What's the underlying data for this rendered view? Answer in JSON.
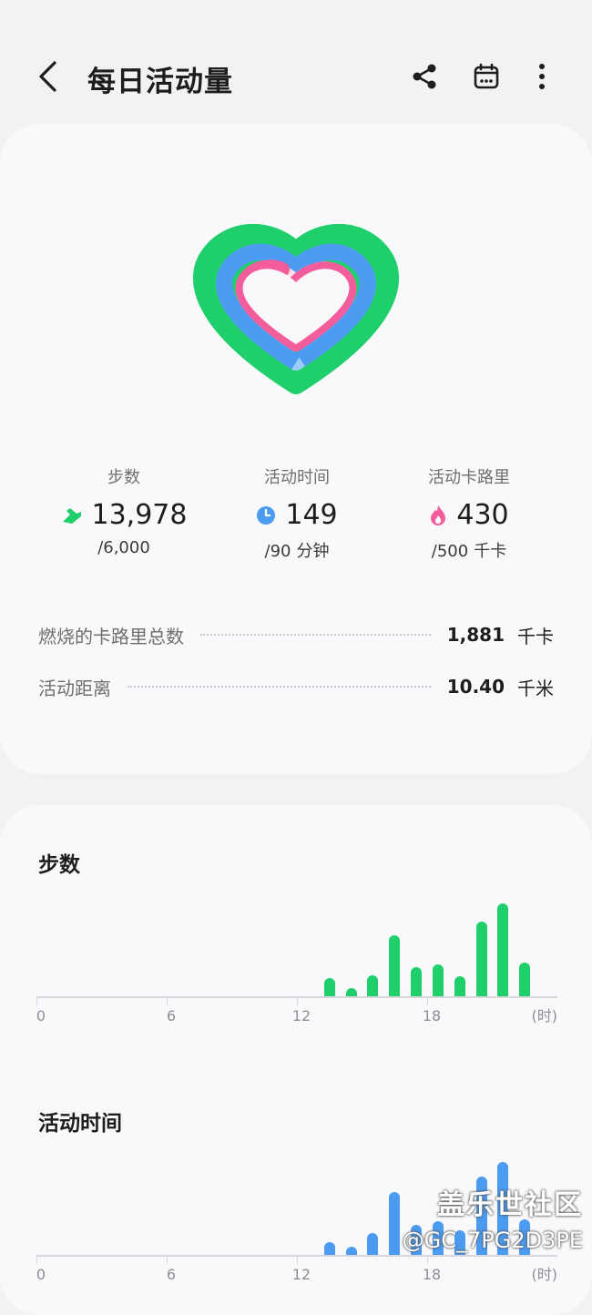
{
  "header": {
    "title": "每日活动量",
    "back_icon": "back-arrow-icon",
    "share_icon": "share-icon",
    "calendar_icon": "calendar-icon",
    "more_icon": "more-vertical-icon"
  },
  "rings": {
    "steps_progress": 1.0,
    "time_progress": 1.0,
    "calories_progress": 0.86,
    "colors": {
      "steps": "#1fcf6b",
      "time": "#4b9bf0",
      "calories": "#f45d9b"
    }
  },
  "stats": [
    {
      "label": "步数",
      "value": "13,978",
      "goal": "/6,000",
      "unit": "",
      "icon": "running-shoe-icon",
      "color": "#1fcf6b"
    },
    {
      "label": "活动时间",
      "value": "149",
      "goal": "/90",
      "unit": "分钟",
      "icon": "clock-icon",
      "color": "#4b9bf0"
    },
    {
      "label": "活动卡路里",
      "value": "430",
      "goal": "/500",
      "unit": "千卡",
      "icon": "flame-icon",
      "color": "#f45d9b"
    }
  ],
  "summary": [
    {
      "label": "燃烧的卡路里总数",
      "value": "1,881",
      "unit": "千卡"
    },
    {
      "label": "活动距离",
      "value": "10.40",
      "unit": "千米"
    }
  ],
  "sections": {
    "steps_title": "步数",
    "time_title": "活动时间"
  },
  "chart_data": [
    {
      "type": "bar",
      "title": "步数",
      "x_unit": "(时)",
      "xticks": [
        "0",
        "6",
        "12",
        "18"
      ],
      "xlim": [
        0,
        24
      ],
      "x": [
        13,
        14,
        15,
        16,
        17,
        18,
        19,
        20,
        21,
        22
      ],
      "values": [
        0.2,
        0.09,
        0.23,
        0.66,
        0.31,
        0.34,
        0.22,
        0.8,
        1.0,
        0.36
      ],
      "color": "#1fcf6b"
    },
    {
      "type": "bar",
      "title": "活动时间",
      "x_unit": "(时)",
      "xticks": [
        "0",
        "6",
        "12",
        "18"
      ],
      "xlim": [
        0,
        24
      ],
      "x": [
        13,
        14,
        15,
        16,
        17,
        18,
        19,
        20,
        21,
        22
      ],
      "values": [
        0.14,
        0.09,
        0.24,
        0.68,
        0.32,
        0.36,
        0.26,
        0.84,
        1.0,
        0.38
      ],
      "color": "#4b9bf0"
    }
  ],
  "watermark": {
    "line1": "盖乐世社区",
    "line2": "@GC_7PG2D3PE"
  }
}
